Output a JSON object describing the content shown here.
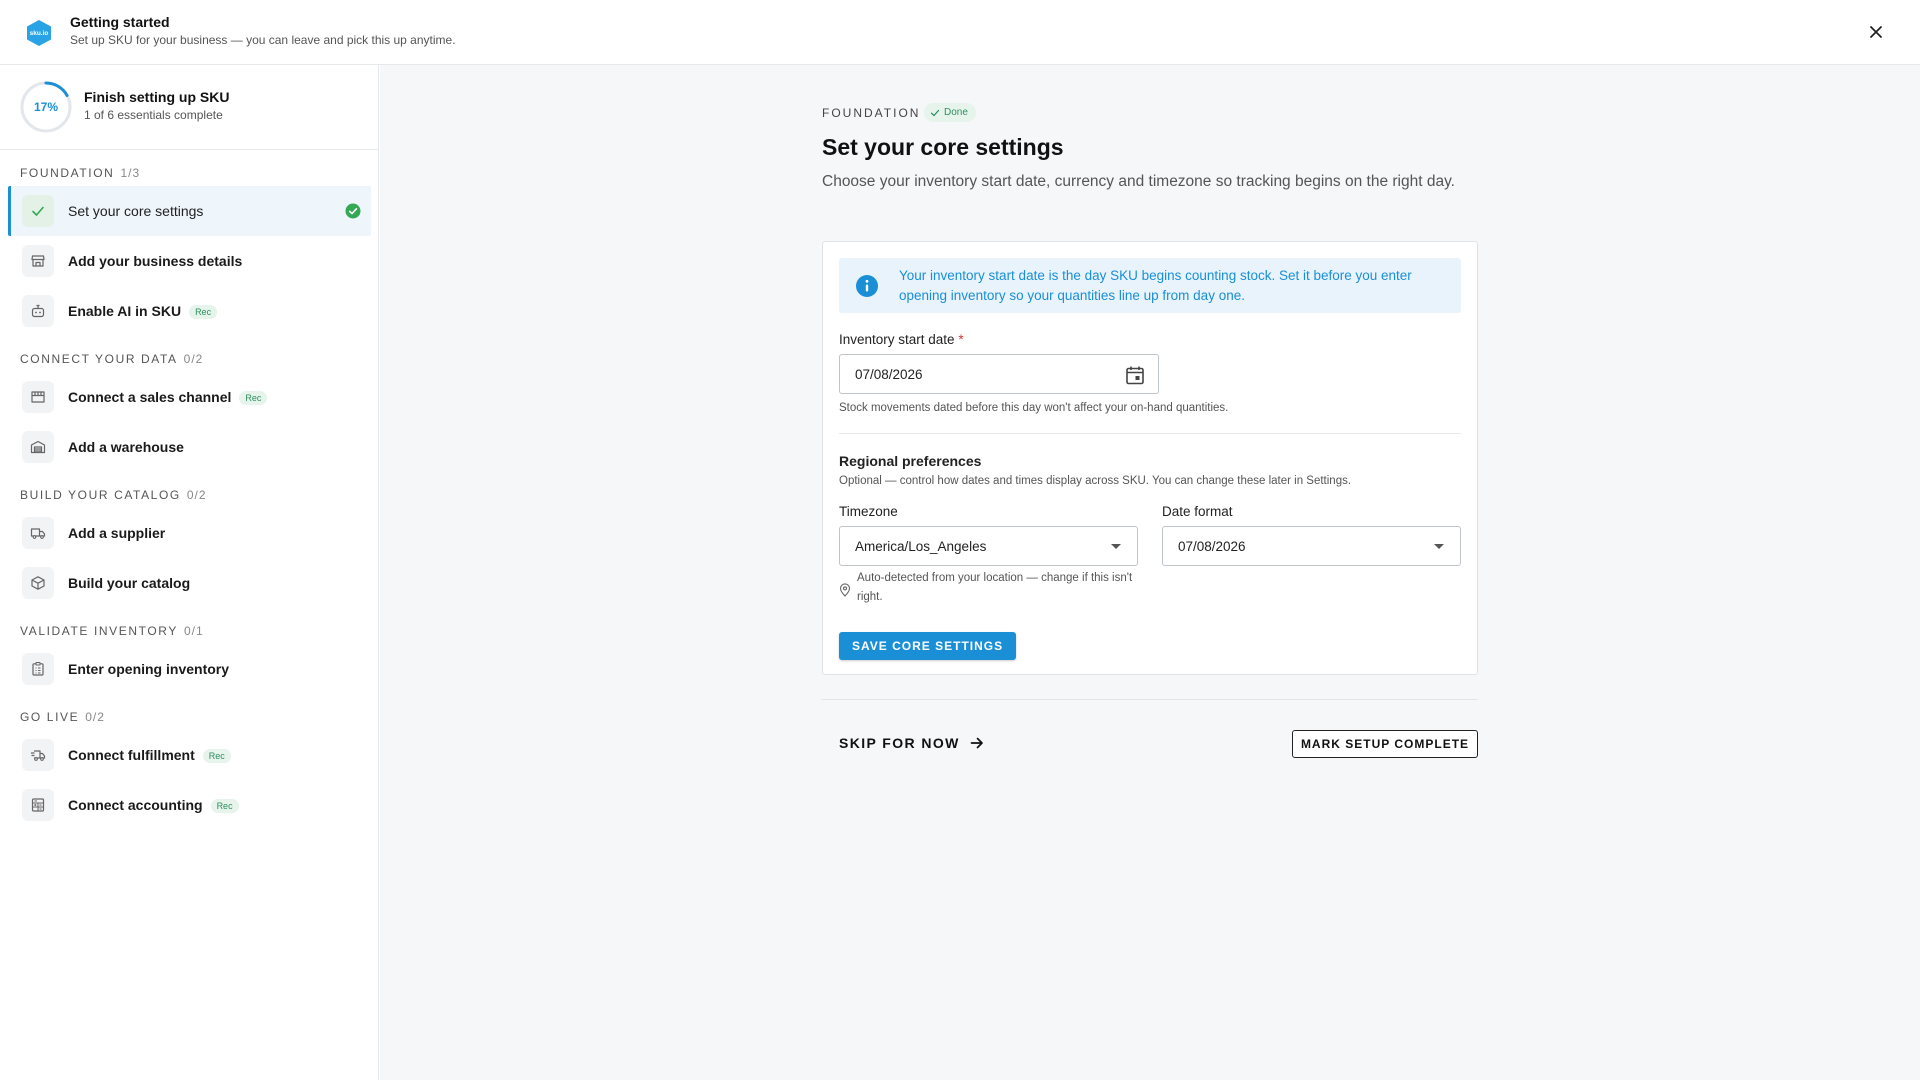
{
  "header": {
    "logo_text": "sku.io",
    "title": "Getting started",
    "subtitle": "Set up SKU for your business — you can leave and pick this up anytime.",
    "close_icon": "close-icon"
  },
  "progress": {
    "percent_label": "17%",
    "percent_value": 0.17,
    "title": "Finish setting up SKU",
    "subtitle": "1 of 6 essentials complete"
  },
  "sections": [
    {
      "title": "Foundation",
      "count": "1/3",
      "items": [
        {
          "label": "Set your core settings",
          "icon": "check-icon",
          "active": true,
          "done": true,
          "rec": ""
        },
        {
          "label": "Add your business details",
          "icon": "storefront-icon",
          "rec": ""
        },
        {
          "label": "Enable AI in SKU",
          "icon": "robot-icon",
          "rec": "Rec"
        }
      ]
    },
    {
      "title": "Connect your data",
      "count": "0/2",
      "items": [
        {
          "label": "Connect a sales channel",
          "icon": "store-icon",
          "rec": "Rec"
        },
        {
          "label": "Add a warehouse",
          "icon": "warehouse-icon",
          "rec": ""
        }
      ]
    },
    {
      "title": "Build your catalog",
      "count": "0/2",
      "items": [
        {
          "label": "Add a supplier",
          "icon": "truck-icon",
          "rec": ""
        },
        {
          "label": "Build your catalog",
          "icon": "box-icon",
          "rec": ""
        }
      ]
    },
    {
      "title": "Validate inventory",
      "count": "0/1",
      "items": [
        {
          "label": "Enter opening inventory",
          "icon": "clipboard-icon",
          "rec": ""
        }
      ]
    },
    {
      "title": "Go live",
      "count": "0/2",
      "items": [
        {
          "label": "Connect fulfillment",
          "icon": "fast-truck-icon",
          "rec": "Rec"
        },
        {
          "label": "Connect accounting",
          "icon": "calculator-icon",
          "rec": "Rec"
        }
      ]
    }
  ],
  "main": {
    "eyebrow": "Foundation",
    "done_label": "Done",
    "title": "Set your core settings",
    "description": "Choose your inventory start date, currency and timezone so tracking begins on the right day.",
    "info_text": "Your inventory start date is the day SKU begins counting stock. Set it before you enter opening inventory so your quantities line up from day one.",
    "start_date_label": "Inventory start date",
    "required_mark": "*",
    "start_date_value": "07/08/2026",
    "start_date_help": "Stock movements dated before this day won't affect your on-hand quantities.",
    "regional_title": "Regional preferences",
    "regional_help": "Optional — control how dates and times display across SKU. You can change these later in Settings.",
    "timezone_label": "Timezone",
    "timezone_value": "America/Los_Angeles",
    "timezone_help": "Auto-detected from your location — change if this isn't right.",
    "date_format_label": "Date format",
    "date_format_value": "07/08/2026",
    "save_label": "SAVE CORE SETTINGS",
    "skip_label": "SKIP FOR NOW",
    "mark_complete_label": "MARK SETUP COMPLETE"
  },
  "colors": {
    "accent": "#1a8fd6",
    "success": "#34a853",
    "info_bg": "#e8f3fc",
    "rec_badge": "#2f8f5f"
  }
}
